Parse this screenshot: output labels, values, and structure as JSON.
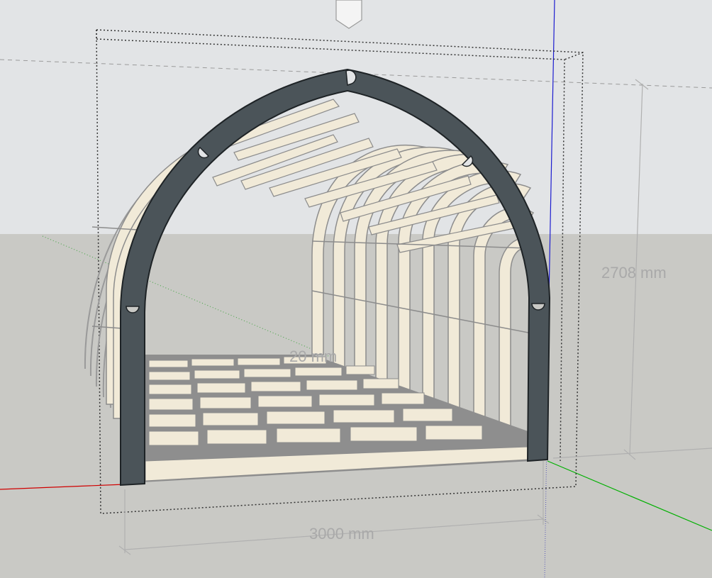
{
  "app": {
    "tool": "SketchUp 3D viewport",
    "view": "perspective"
  },
  "colors": {
    "sky": "#e2e4e6",
    "ground": "#c9c9c5",
    "front_arch": "#4b5459",
    "ribs": "#f1ead8",
    "rib_outline": "#8c8c8c",
    "axis_red": "#d00000",
    "axis_green": "#00b000",
    "axis_blue": "#0000d0",
    "dimension_text": "#a9a9a9"
  },
  "dimensions": {
    "height_label": "2708 mm",
    "width_label": "3000 mm",
    "hidden_label": "20 mm"
  },
  "model": {
    "description_visible": false,
    "arch_segments_joints": 5
  }
}
